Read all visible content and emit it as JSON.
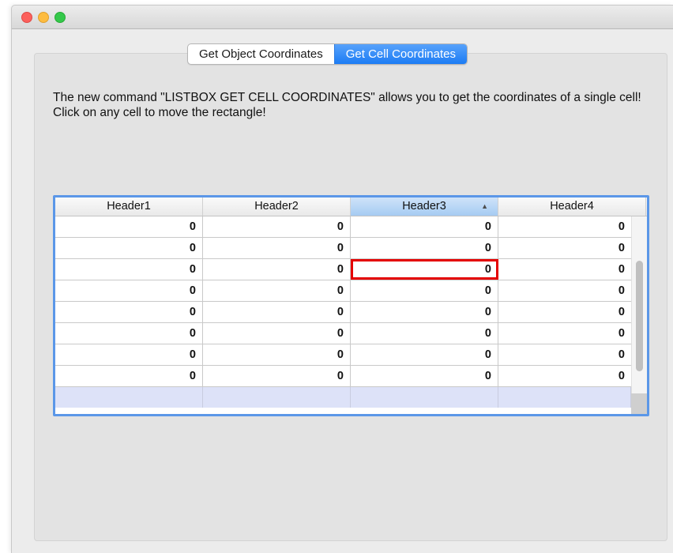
{
  "window": {
    "controls": [
      "close",
      "minimize",
      "maximize"
    ]
  },
  "tabs": [
    {
      "label": "Get Object Coordinates",
      "selected": false
    },
    {
      "label": "Get Cell Coordinates",
      "selected": true
    }
  ],
  "description": "The new command \"LISTBOX GET CELL COORDINATES\" allows you to get the coordinates of a single cell! Click on any cell to move the rectangle!",
  "listbox": {
    "headers": [
      "Header1",
      "Header2",
      "Header3",
      "Header4"
    ],
    "sorted_column": "Header3",
    "sort_indicator": "▲",
    "rows": [
      [
        "0",
        "0",
        "0",
        "0"
      ],
      [
        "0",
        "0",
        "0",
        "0"
      ],
      [
        "0",
        "0",
        "0",
        "0"
      ],
      [
        "0",
        "0",
        "0",
        "0"
      ],
      [
        "0",
        "0",
        "0",
        "0"
      ],
      [
        "0",
        "0",
        "0",
        "0"
      ],
      [
        "0",
        "0",
        "0",
        "0"
      ],
      [
        "0",
        "0",
        "0",
        "0"
      ]
    ],
    "highlighted_cell": {
      "row": 3,
      "column": 3
    },
    "highlight_color": "#e40000",
    "selection_color": "#dde2f8",
    "focus_border_color": "#5b97e8"
  },
  "colors": {
    "accent": "#1c7cf4",
    "close": "#fc605c",
    "minimize": "#fdbc40",
    "maximize": "#34c84a"
  }
}
